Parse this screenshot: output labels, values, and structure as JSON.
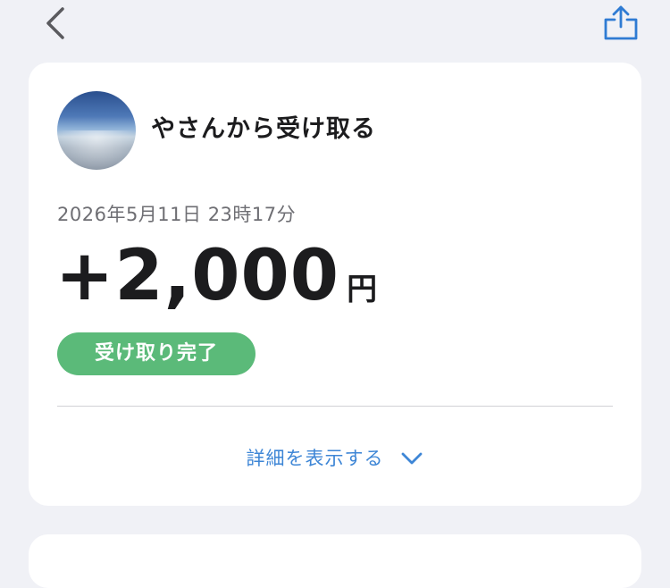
{
  "header": {
    "back_icon": "chevron-left-icon",
    "share_icon": "share-icon"
  },
  "transaction": {
    "title": "やさんから受け取る",
    "datetime": "2026年5月11日 23時17分",
    "amount": "+2,000",
    "currency": "円",
    "status": "受け取り完了",
    "details_label": "詳細を表示する",
    "details_icon": "chevron-down-icon"
  },
  "colors": {
    "background": "#f0f1f6",
    "card": "#ffffff",
    "accent_blue": "#3e86d6",
    "status_green": "#5bba79",
    "text_primary": "#1c1c1e",
    "text_secondary": "#6e6e73"
  }
}
